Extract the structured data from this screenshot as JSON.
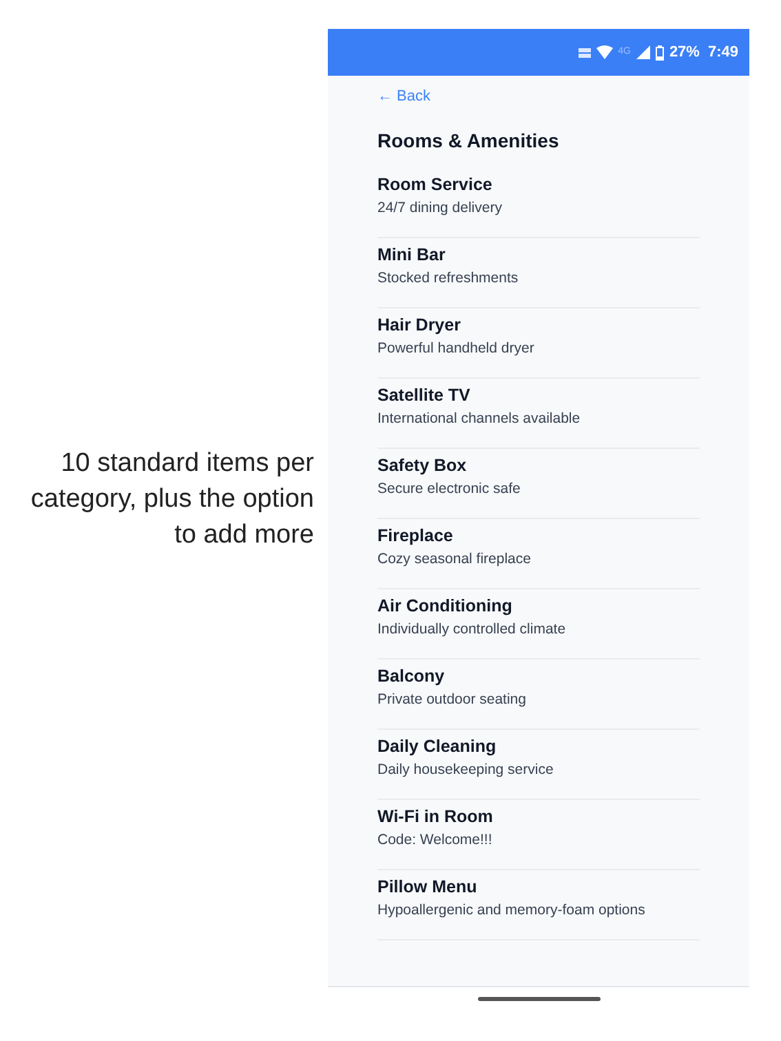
{
  "caption": "10 standard items per category, plus the option to add more",
  "status_bar": {
    "network": "4G",
    "battery": "27%",
    "time": "7:49"
  },
  "back_link": "← Back",
  "title": "Rooms & Amenities",
  "items": [
    {
      "name": "Room Service",
      "description": "24/7 dining delivery"
    },
    {
      "name": "Mini Bar",
      "description": "Stocked refreshments"
    },
    {
      "name": "Hair Dryer",
      "description": "Powerful handheld dryer"
    },
    {
      "name": "Satellite TV",
      "description": "International channels available"
    },
    {
      "name": "Safety Box",
      "description": "Secure electronic safe"
    },
    {
      "name": "Fireplace",
      "description": "Cozy seasonal fireplace"
    },
    {
      "name": "Air Conditioning",
      "description": "Individually controlled climate"
    },
    {
      "name": "Balcony",
      "description": "Private outdoor seating"
    },
    {
      "name": "Daily Cleaning",
      "description": "Daily housekeeping service"
    },
    {
      "name": "Wi-Fi in Room",
      "description": "Code: Welcome!!!"
    },
    {
      "name": "Pillow Menu",
      "description": "Hypoallergenic and memory-foam options"
    }
  ]
}
